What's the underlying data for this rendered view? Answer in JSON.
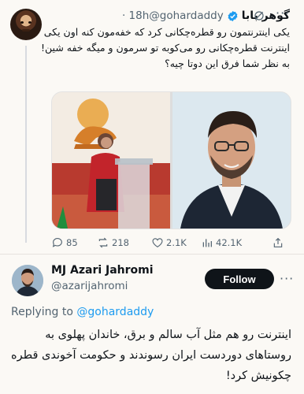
{
  "tweet": {
    "display_name": "گوهر بابا",
    "handle": "@gohardaddy",
    "time": "· 18h",
    "text": "یکی اینترنتمون رو قطره‌چکانی کرد که خفه‌مون کنه اون یکی اینترنت قطره‌چکانی رو می‌کوبه تو سرمون و میگه خفه شین! به نظر شما فرق این دوتا چیه؟",
    "stats": {
      "replies": "85",
      "reposts": "218",
      "likes": "2.1K",
      "views": "42.1K"
    }
  },
  "reply": {
    "display_name": "MJ Azari Jahromi",
    "handle": "@azarijahromi",
    "follow_label": "Follow",
    "replying_prefix": "Replying to",
    "replying_handle": "@gohardaddy",
    "text": "اینترنت رو هم مثل آب سالم و برق، خاندان پهلوی به روستاهای دوردست ایران رسوندند و حکومت آخوندی قطره چکونیش کرد!"
  },
  "colors": {
    "accent": "#1d9bf0",
    "verified": "#1d9bf0",
    "text_secondary": "#536471",
    "follow_bg": "#0f1419"
  },
  "icons": {
    "verified": "verified-badge-icon",
    "grok": "grok-icon",
    "more": "more-icon",
    "reply": "reply-icon",
    "repost": "repost-icon",
    "like": "heart-icon",
    "views": "views-icon",
    "share": "share-icon"
  }
}
